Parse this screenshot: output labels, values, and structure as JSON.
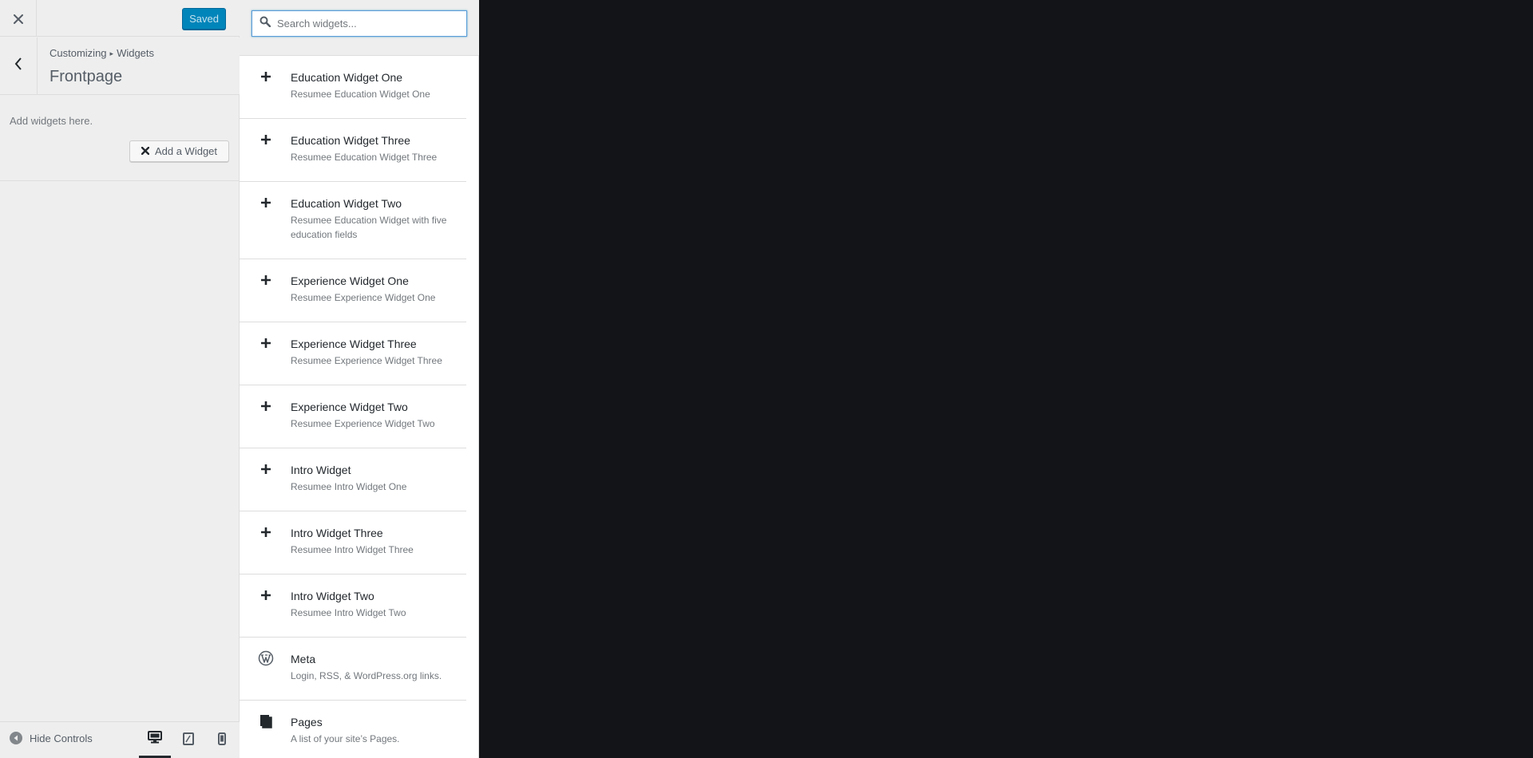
{
  "header": {
    "close_icon": "close-icon",
    "save_label": "Saved"
  },
  "section": {
    "breadcrumb_root": "Customizing",
    "breadcrumb_separator_icon": "triangle-right-icon",
    "breadcrumb_current": "Widgets",
    "title": "Frontpage"
  },
  "sidebar": {
    "description": "Add widgets here.",
    "add_widget_label": "Add a Widget"
  },
  "footer": {
    "hide_controls_label": "Hide Controls",
    "devices": [
      "desktop",
      "tablet",
      "mobile"
    ],
    "active_device": "desktop"
  },
  "search": {
    "placeholder": "Search widgets...",
    "value": ""
  },
  "widgets": [
    {
      "icon": "plus-icon",
      "title": "Education Widget One",
      "desc": "Resumee Education Widget One"
    },
    {
      "icon": "plus-icon",
      "title": "Education Widget Three",
      "desc": "Resumee Education Widget Three"
    },
    {
      "icon": "plus-icon",
      "title": "Education Widget Two",
      "desc": "Resumee Education Widget with five education fields"
    },
    {
      "icon": "plus-icon",
      "title": "Experience Widget One",
      "desc": "Resumee Experience Widget One"
    },
    {
      "icon": "plus-icon",
      "title": "Experience Widget Three",
      "desc": "Resumee Experience Widget Three"
    },
    {
      "icon": "plus-icon",
      "title": "Experience Widget Two",
      "desc": "Resumee Experience Widget Two"
    },
    {
      "icon": "plus-icon",
      "title": "Intro Widget",
      "desc": "Resumee Intro Widget One"
    },
    {
      "icon": "plus-icon",
      "title": "Intro Widget Three",
      "desc": "Resumee Intro Widget Three"
    },
    {
      "icon": "plus-icon",
      "title": "Intro Widget Two",
      "desc": "Resumee Intro Widget Two"
    },
    {
      "icon": "wordpress-icon",
      "title": "Meta",
      "desc": "Login, RSS, & WordPress.org links."
    },
    {
      "icon": "pages-icon",
      "title": "Pages",
      "desc": "A list of your site’s Pages."
    }
  ],
  "colors": {
    "primary_button": "#0085ba",
    "preview_background": "#121417",
    "panel_background": "#eeeeee"
  }
}
